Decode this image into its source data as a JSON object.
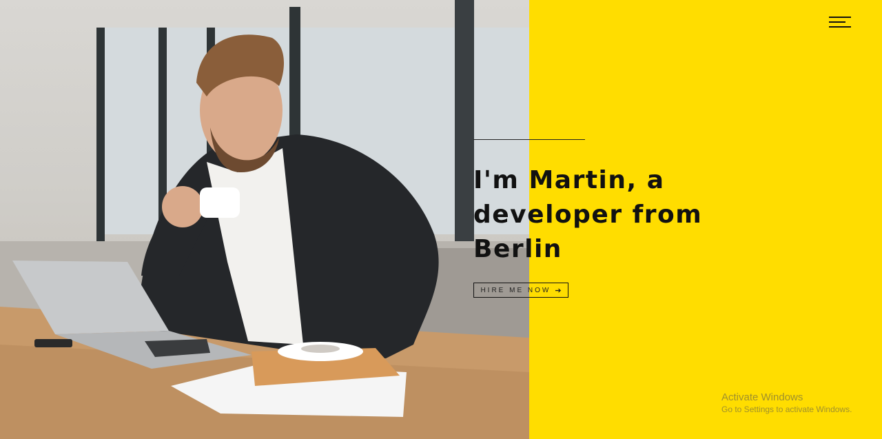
{
  "header": {
    "menu_icon": "hamburger-menu-icon"
  },
  "hero": {
    "headline_line1": "I'm Martin, a",
    "headline_line2": "developer from",
    "headline_line3": "Berlin",
    "cta_label": "HIRE ME NOW",
    "cta_icon": "arrow-right-icon",
    "cta_arrow": "➔"
  },
  "photo": {
    "description_icon": "hero-photo"
  },
  "watermark": {
    "title": "Activate Windows",
    "subtitle": "Go to Settings to activate Windows."
  },
  "colors": {
    "accent": "#ffdd00",
    "text": "#111111"
  }
}
